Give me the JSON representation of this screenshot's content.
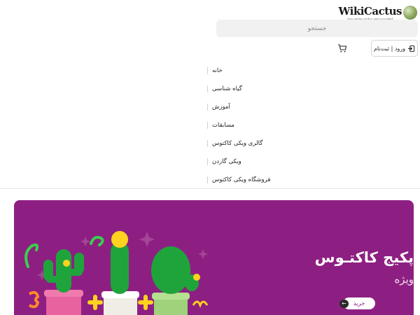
{
  "header": {
    "logo_text": "WikiCactus",
    "logo_subtext": "Iran online cactus and succulent",
    "search_placeholder": "جستجو",
    "login_label": "ورود | ثبت‌نام"
  },
  "nav": {
    "items": [
      {
        "label": "خانه"
      },
      {
        "label": "گیاه شناسی"
      },
      {
        "label": "آموزش"
      },
      {
        "label": "مسابقات"
      },
      {
        "label": "گالری ویکی کاکتوس"
      },
      {
        "label": "ویکی گاردن"
      },
      {
        "label": "فروشگاه ویکی کاکتوس"
      }
    ]
  },
  "banner": {
    "title": "پکیج کاکتـوس",
    "subtitle": "ویژه",
    "buy_label": "خرید",
    "background": "#8e1f82"
  },
  "icons": {
    "login": "login-icon",
    "cart": "cart-icon",
    "arrow": "arrow-left-icon"
  }
}
